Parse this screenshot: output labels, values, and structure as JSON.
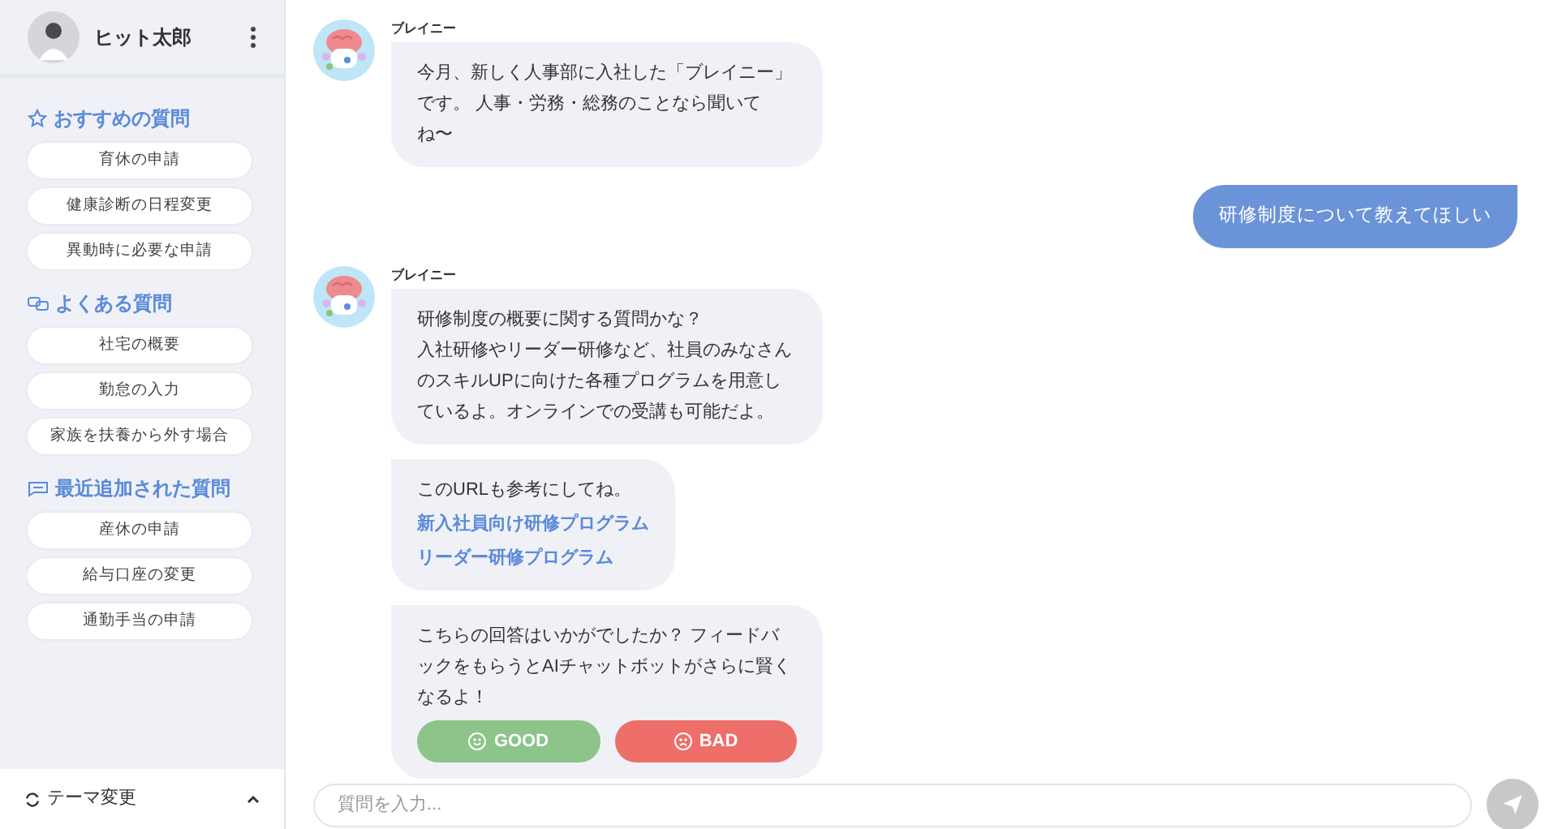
{
  "user": {
    "name": "ヒット太郎"
  },
  "sections": [
    {
      "kind": "star",
      "title": "おすすめの質問",
      "items": [
        "育休の申請",
        "健康診断の日程変更",
        "異動時に必要な申請"
      ]
    },
    {
      "kind": "faq",
      "title": "よくある質問",
      "items": [
        "社宅の概要",
        "勤怠の入力",
        "家族を扶養から外す場合"
      ]
    },
    {
      "kind": "recent",
      "title": "最近追加された質問",
      "items": [
        "産休の申請",
        "給与口座の変更",
        "通勤手当の申請"
      ]
    }
  ],
  "theme_toggle": {
    "label": "テーマ変更",
    "expanded": false
  },
  "messages": [
    {
      "kind": "bot",
      "sender": "ブレイニー",
      "lines": [
        "今月、新しく人事部に入社した「ブレイニー」です。 人事・労務・総務のことなら聞いてね〜"
      ]
    },
    {
      "kind": "user",
      "text": "研修制度について教えてほしい"
    },
    {
      "kind": "bot",
      "sender": "ブレイニー",
      "lines": [
        "研修制度の概要に関する質問かな？",
        "入社研修やリーダー研修など、社員のみなさんのスキルUPに向けた各種プログラムを用意しているよ。オンラインでの受講も可能だよ。"
      ]
    },
    {
      "kind": "links",
      "text": "このURLも参考にしてね。",
      "links": [
        "新入社員向け研修プログラム",
        "リーダー研修プログラム"
      ]
    },
    {
      "kind": "feedback",
      "text": "こちらの回答はいかがでしたか？ フィードバックをもらうとAIチャットボットがさらに賢くなるよ！",
      "good": "GOOD",
      "bad": "BAD"
    }
  ],
  "composer": {
    "placeholder": "質問を入力..."
  }
}
